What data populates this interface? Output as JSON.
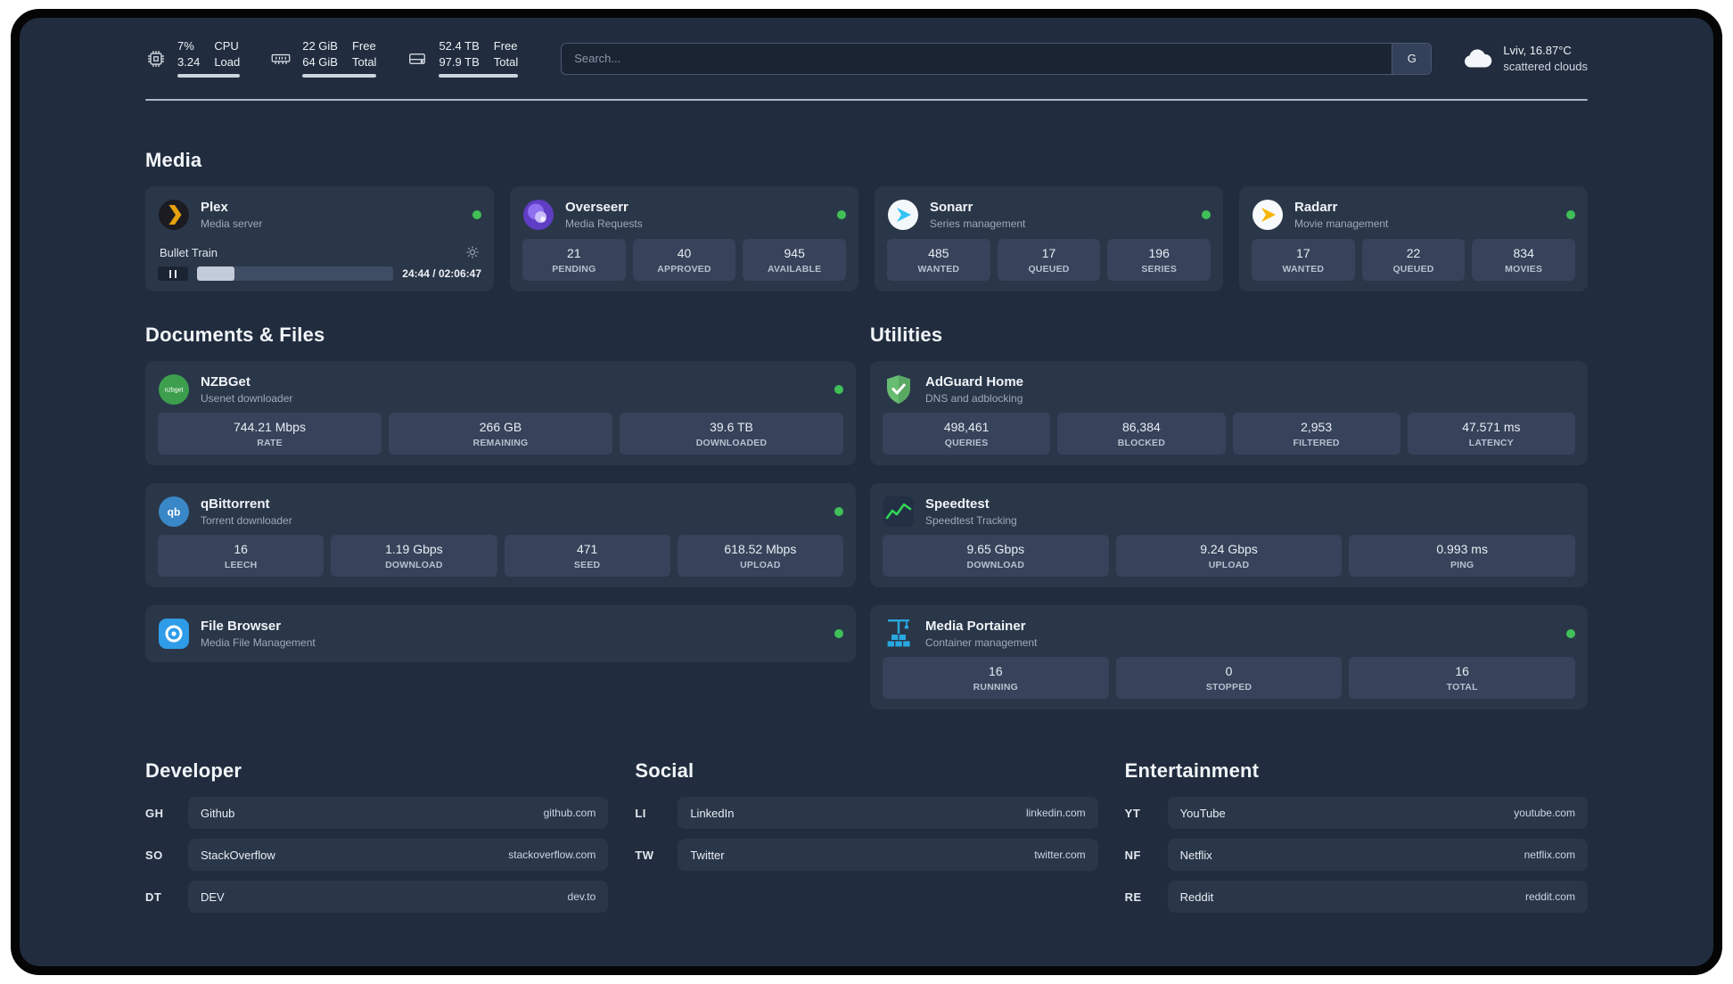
{
  "colors": {
    "status_online": "#40c057"
  },
  "header": {
    "cpu": {
      "value": "7%",
      "load": "3.24",
      "label1": "CPU",
      "label2": "Load"
    },
    "ram": {
      "value": "22 GiB",
      "total": "64 GiB",
      "label1": "Free",
      "label2": "Total"
    },
    "disk": {
      "value": "52.4 TB",
      "total": "97.9 TB",
      "label1": "Free",
      "label2": "Total"
    },
    "meters": {
      "cpu": 100,
      "ram": 100,
      "disk": 100
    },
    "search": {
      "placeholder": "Search...",
      "engine_label": "G"
    },
    "weather": {
      "location": "Lviv, 16.87°C",
      "condition": "scattered clouds"
    }
  },
  "media": {
    "title": "Media",
    "plex": {
      "name": "Plex",
      "subtitle": "Media server",
      "now_playing": "Bullet Train",
      "time": "24:44 / 02:06:47",
      "progress": 19
    },
    "overseerr": {
      "name": "Overseerr",
      "subtitle": "Media Requests",
      "stats": [
        {
          "value": "21",
          "label": "PENDING"
        },
        {
          "value": "40",
          "label": "APPROVED"
        },
        {
          "value": "945",
          "label": "AVAILABLE"
        }
      ]
    },
    "sonarr": {
      "name": "Sonarr",
      "subtitle": "Series management",
      "stats": [
        {
          "value": "485",
          "label": "WANTED"
        },
        {
          "value": "17",
          "label": "QUEUED"
        },
        {
          "value": "196",
          "label": "SERIES"
        }
      ]
    },
    "radarr": {
      "name": "Radarr",
      "subtitle": "Movie management",
      "stats": [
        {
          "value": "17",
          "label": "WANTED"
        },
        {
          "value": "22",
          "label": "QUEUED"
        },
        {
          "value": "834",
          "label": "MOVIES"
        }
      ]
    }
  },
  "documents": {
    "title": "Documents & Files",
    "nzbget": {
      "name": "NZBGet",
      "subtitle": "Usenet downloader",
      "icon_text": "nzbget",
      "stats": [
        {
          "value": "744.21 Mbps",
          "label": "RATE"
        },
        {
          "value": "266 GB",
          "label": "REMAINING"
        },
        {
          "value": "39.6 TB",
          "label": "DOWNLOADED"
        }
      ]
    },
    "qbittorrent": {
      "name": "qBittorrent",
      "subtitle": "Torrent downloader",
      "icon_text": "qb",
      "stats": [
        {
          "value": "16",
          "label": "LEECH"
        },
        {
          "value": "1.19 Gbps",
          "label": "DOWNLOAD"
        },
        {
          "value": "471",
          "label": "SEED"
        },
        {
          "value": "618.52 Mbps",
          "label": "UPLOAD"
        }
      ]
    },
    "filebrowser": {
      "name": "File Browser",
      "subtitle": "Media File Management"
    }
  },
  "utilities": {
    "title": "Utilities",
    "adguard": {
      "name": "AdGuard Home",
      "subtitle": "DNS and adblocking",
      "stats": [
        {
          "value": "498,461",
          "label": "QUERIES"
        },
        {
          "value": "86,384",
          "label": "BLOCKED"
        },
        {
          "value": "2,953",
          "label": "FILTERED"
        },
        {
          "value": "47.571 ms",
          "label": "LATENCY"
        }
      ]
    },
    "speedtest": {
      "name": "Speedtest",
      "subtitle": "Speedtest Tracking",
      "stats": [
        {
          "value": "9.65 Gbps",
          "label": "DOWNLOAD"
        },
        {
          "value": "9.24 Gbps",
          "label": "UPLOAD"
        },
        {
          "value": "0.993 ms",
          "label": "PING"
        }
      ]
    },
    "portainer": {
      "name": "Media Portainer",
      "subtitle": "Container management",
      "stats": [
        {
          "value": "16",
          "label": "RUNNING"
        },
        {
          "value": "0",
          "label": "STOPPED"
        },
        {
          "value": "16",
          "label": "TOTAL"
        }
      ]
    }
  },
  "links": {
    "developer": {
      "title": "Developer",
      "items": [
        {
          "abbr": "GH",
          "name": "Github",
          "url": "github.com"
        },
        {
          "abbr": "SO",
          "name": "StackOverflow",
          "url": "stackoverflow.com"
        },
        {
          "abbr": "DT",
          "name": "DEV",
          "url": "dev.to"
        }
      ]
    },
    "social": {
      "title": "Social",
      "items": [
        {
          "abbr": "LI",
          "name": "LinkedIn",
          "url": "linkedin.com"
        },
        {
          "abbr": "TW",
          "name": "Twitter",
          "url": "twitter.com"
        }
      ]
    },
    "entertainment": {
      "title": "Entertainment",
      "items": [
        {
          "abbr": "YT",
          "name": "YouTube",
          "url": "youtube.com"
        },
        {
          "abbr": "NF",
          "name": "Netflix",
          "url": "netflix.com"
        },
        {
          "abbr": "RE",
          "name": "Reddit",
          "url": "reddit.com"
        }
      ]
    }
  }
}
